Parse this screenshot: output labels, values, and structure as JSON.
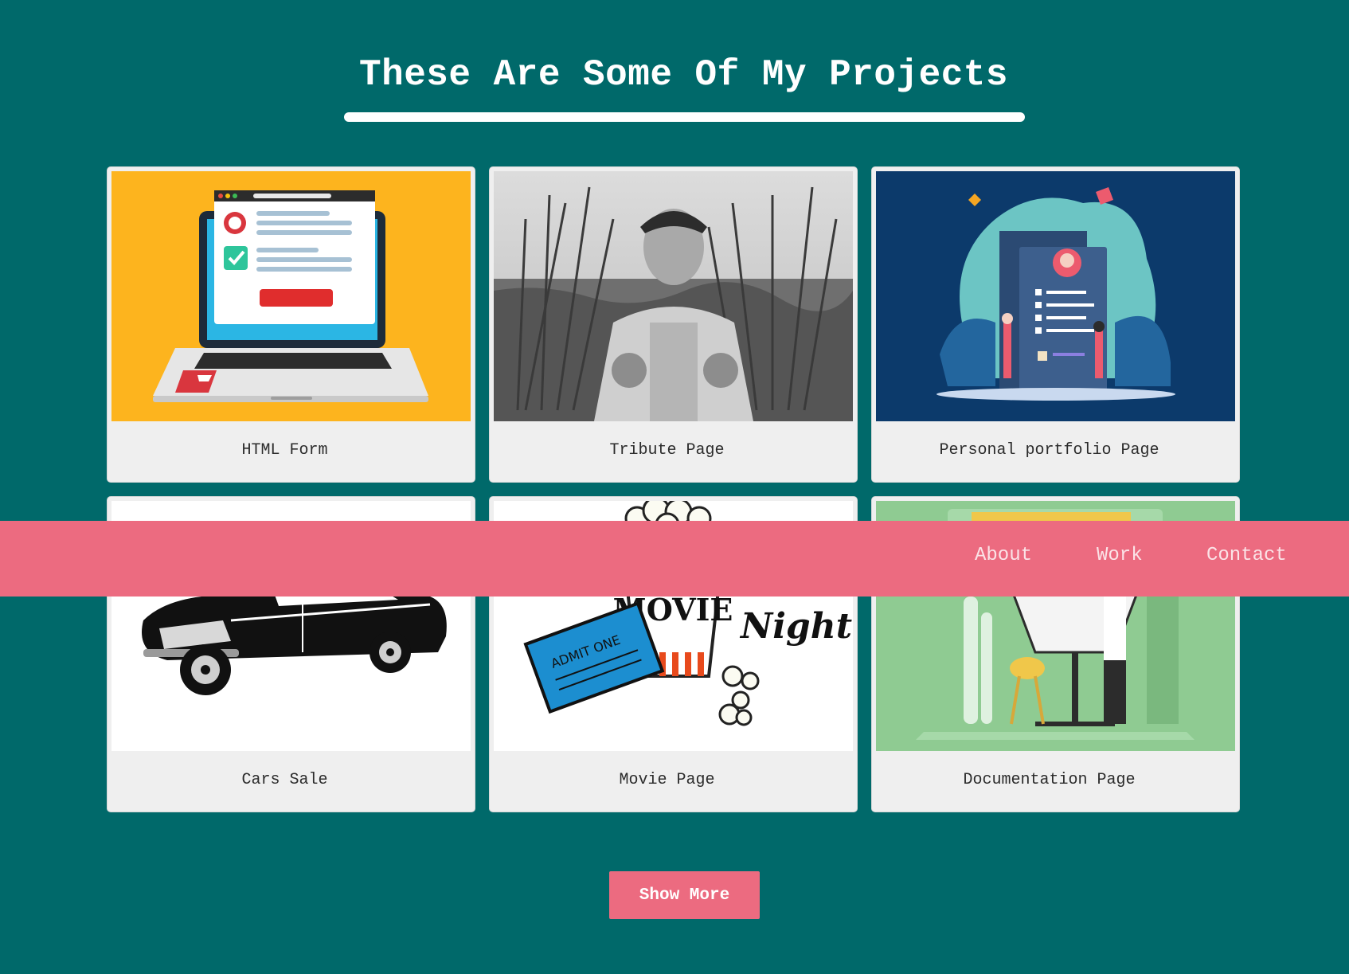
{
  "projects_section": {
    "heading": "These Are Some Of My Projects",
    "cards": [
      {
        "caption": "HTML Form",
        "image_icon": "laptop-form-icon"
      },
      {
        "caption": "Tribute Page",
        "image_icon": "farmer-photo"
      },
      {
        "caption": "Personal portfolio Page",
        "image_icon": "portfolio-illustration"
      },
      {
        "caption": "Cars Sale",
        "image_icon": "classic-car-icon"
      },
      {
        "caption": "Movie Page",
        "image_icon": "movie-night-icon",
        "image_text": {
          "ticket": "ADMIT ONE",
          "word": "Night",
          "marquee": "MOVIE"
        }
      },
      {
        "caption": "Documentation Page",
        "image_icon": "architect-desk-illustration"
      }
    ],
    "show_more_label": "Show More"
  },
  "navbar": {
    "links": [
      "About",
      "Work",
      "Contact"
    ]
  },
  "colors": {
    "background": "#00696a",
    "accent": "#ec6b80",
    "card": "#efefef"
  }
}
